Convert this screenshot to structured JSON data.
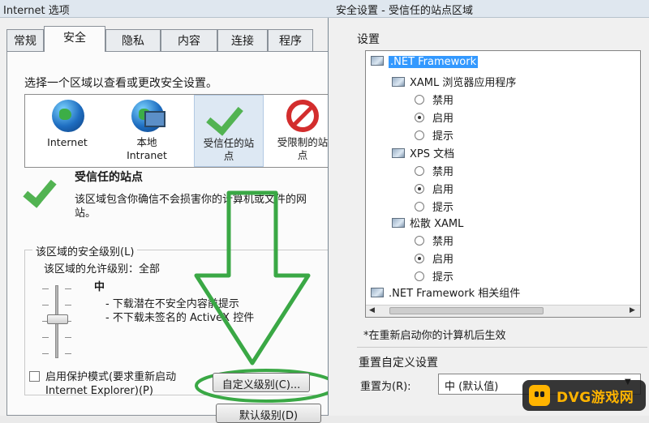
{
  "left_dialog": {
    "title": "Internet 选项",
    "tabs": [
      "常规",
      "安全",
      "隐私",
      "内容",
      "连接",
      "程序"
    ],
    "active_tab": "安全",
    "instruction": "选择一个区域以查看或更改安全设置。",
    "zones": [
      {
        "label": "Internet",
        "label2": ""
      },
      {
        "label": "本地",
        "label2": "Intranet"
      },
      {
        "label": "受信任的站",
        "label2": "点"
      },
      {
        "label": "受限制的站",
        "label2": "点"
      }
    ],
    "selected_zone": "受信任的站点",
    "zone_heading": "受信任的站点",
    "zone_description": "该区域包含你确信不会损害你的计算机或文件的网站。",
    "security_level_title": "该区域的安全级别(L)",
    "allowed_levels": "该区域的允许级别：全部",
    "level_name": "中",
    "level_bullets": [
      "- 下载潜在不安全内容前提示",
      "- 不下载未签名的 ActiveX 控件"
    ],
    "protected_mode_line1": "启用保护模式(要求重新启动",
    "protected_mode_line2": "Internet Explorer)(P)",
    "custom_level_button": "自定义级别(C)...",
    "default_level_button": "默认级别(D)",
    "icons": {
      "check": "checkmark-icon",
      "arrow": "down-arrow-annotation"
    },
    "colors": {
      "highlight_green": "#3aa845",
      "check_green": "#52b352"
    }
  },
  "right_dialog": {
    "title": "安全设置 - 受信任的站点区域",
    "settings_label": "设置",
    "tree": [
      {
        "type": "group",
        "label": ".NET Framework",
        "selected": true
      },
      {
        "type": "item",
        "label": "XAML 浏览器应用程序"
      },
      {
        "type": "option",
        "label": "禁用",
        "checked": false
      },
      {
        "type": "option",
        "label": "启用",
        "checked": true
      },
      {
        "type": "option",
        "label": "提示",
        "checked": false
      },
      {
        "type": "item",
        "label": "XPS 文档"
      },
      {
        "type": "option",
        "label": "禁用",
        "checked": false
      },
      {
        "type": "option",
        "label": "启用",
        "checked": true
      },
      {
        "type": "option",
        "label": "提示",
        "checked": false
      },
      {
        "type": "item",
        "label": "松散 XAML"
      },
      {
        "type": "option",
        "label": "禁用",
        "checked": false
      },
      {
        "type": "option",
        "label": "启用",
        "checked": true
      },
      {
        "type": "option",
        "label": "提示",
        "checked": false
      },
      {
        "type": "group",
        "label": ".NET Framework 相关组件",
        "selected": false
      }
    ],
    "restart_note": "*在重新启动你的计算机后生效",
    "reset_title": "重置自定义设置",
    "reset_to_label": "重置为(R):",
    "reset_value": "中 (默认值)"
  },
  "watermark": {
    "text": "DVG游戏网"
  }
}
